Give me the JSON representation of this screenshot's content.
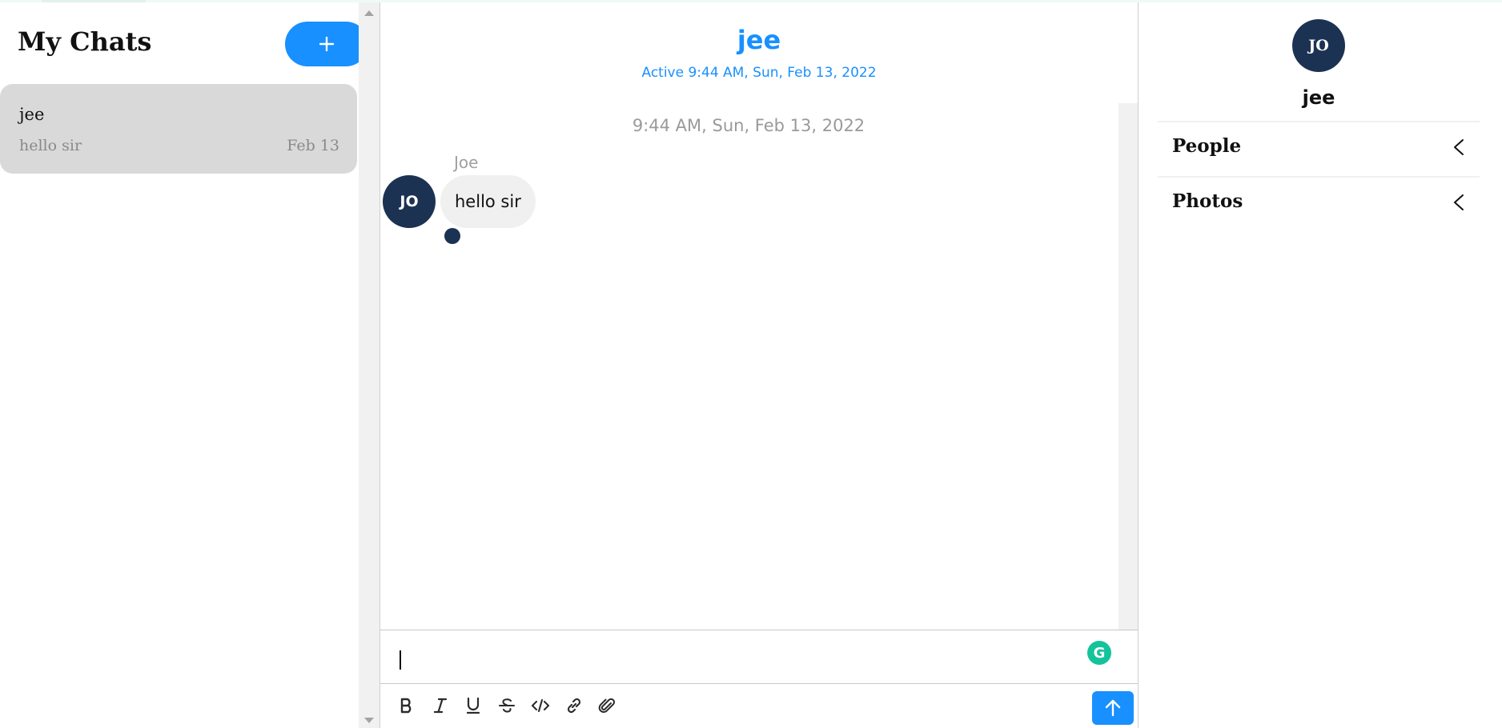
{
  "sidebar": {
    "title": "My Chats",
    "new_chat_icon": "plus-icon",
    "chats": [
      {
        "name": "jee",
        "last_message": "hello sir",
        "date": "Feb 13"
      }
    ]
  },
  "chat": {
    "title": "jee",
    "status": "Active 9:44 AM, Sun, Feb 13, 2022",
    "messages": [
      {
        "timestamp": "9:44 AM, Sun, Feb 13, 2022",
        "sender": "Joe",
        "avatar_initials": "JO",
        "text": "hello sir"
      }
    ],
    "input_value": "",
    "grammarly_label": "G",
    "toolbar": [
      "bold-icon",
      "italic-icon",
      "underline-icon",
      "strikethrough-icon",
      "code-icon",
      "link-icon",
      "attachment-icon"
    ],
    "send_icon": "arrow-up-icon"
  },
  "details": {
    "avatar_initials": "JO",
    "name": "jee",
    "sections": [
      {
        "label": "People"
      },
      {
        "label": "Photos"
      }
    ]
  },
  "colors": {
    "accent": "#1890ff",
    "avatar_bg": "#1c3252",
    "selected_chat_bg": "#d9d9d9",
    "bubble_bg": "#f0f0f0",
    "grammarly": "#15c39a"
  }
}
